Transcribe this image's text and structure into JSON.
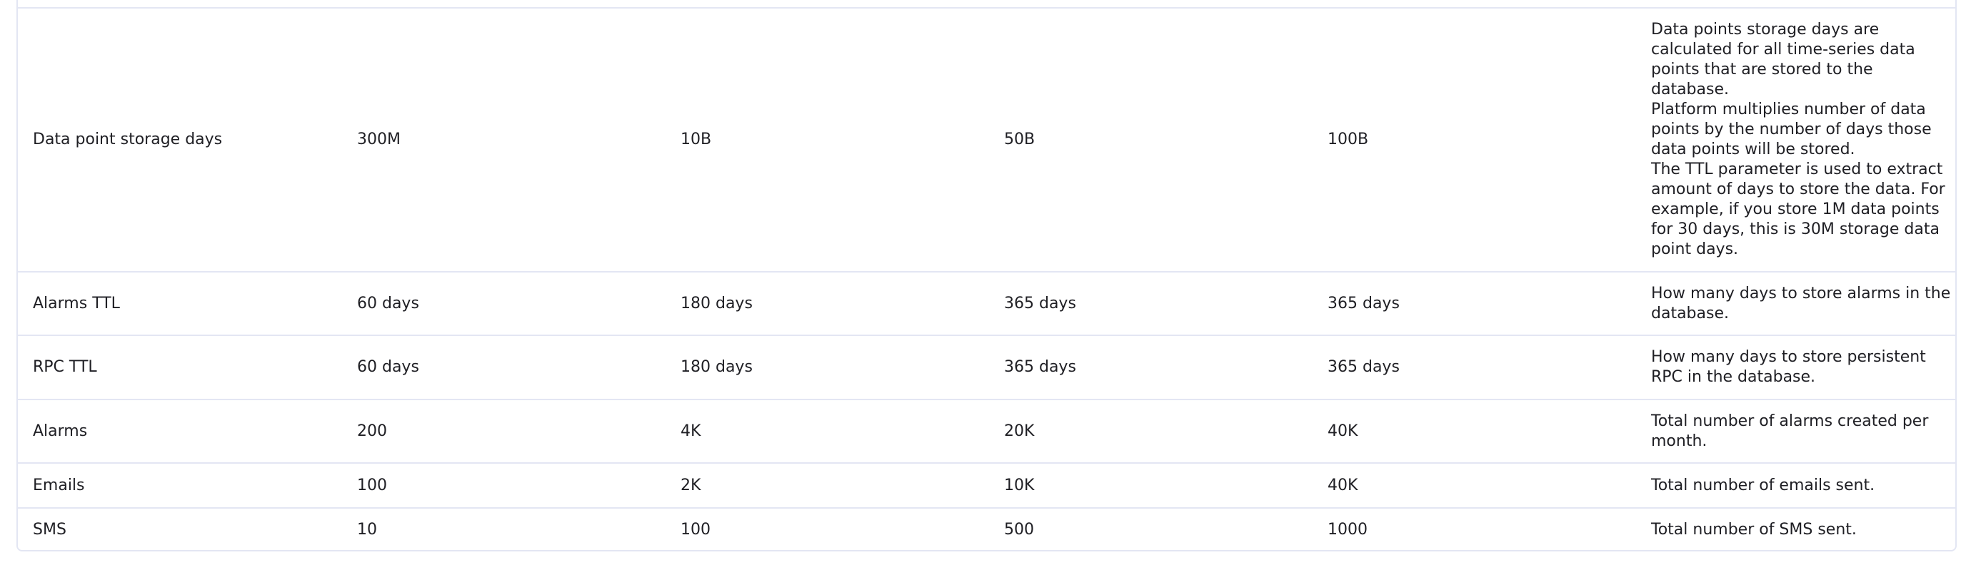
{
  "table": {
    "rows": [
      {
        "name": "Data point storage days",
        "v1": "300M",
        "v2": "10B",
        "v3": "50B",
        "v4": "100B",
        "description_lines": [
          "Data points storage days are",
          "calculated for all time-series data",
          "points that are stored to the",
          "database.",
          "Platform multiplies number of data",
          "points by the number of days those",
          "data points will be stored.",
          "The TTL parameter is used to extract",
          "amount of days to store the data. For",
          "example, if you store 1M data points",
          "for 30 days, this is 30M storage data",
          "point days."
        ]
      },
      {
        "name": "Alarms TTL",
        "v1": "60 days",
        "v2": "180 days",
        "v3": "365 days",
        "v4": "365 days",
        "description_lines": [
          "How many days to store alarms in the",
          "database."
        ]
      },
      {
        "name": "RPC TTL",
        "v1": "60 days",
        "v2": "180 days",
        "v3": "365 days",
        "v4": "365 days",
        "description_lines": [
          "How many days to store persistent",
          "RPC in the database."
        ]
      },
      {
        "name": "Alarms",
        "v1": "200",
        "v2": "4K",
        "v3": "20K",
        "v4": "40K",
        "description_lines": [
          "Total number of alarms created per",
          "month."
        ]
      },
      {
        "name": "Emails",
        "v1": "100",
        "v2": "2K",
        "v3": "10K",
        "v4": "40K",
        "description_lines": [
          "Total number of emails sent."
        ]
      },
      {
        "name": "SMS",
        "v1": "10",
        "v2": "100",
        "v3": "500",
        "v4": "1000",
        "description_lines": [
          "Total number of SMS sent."
        ]
      }
    ]
  }
}
